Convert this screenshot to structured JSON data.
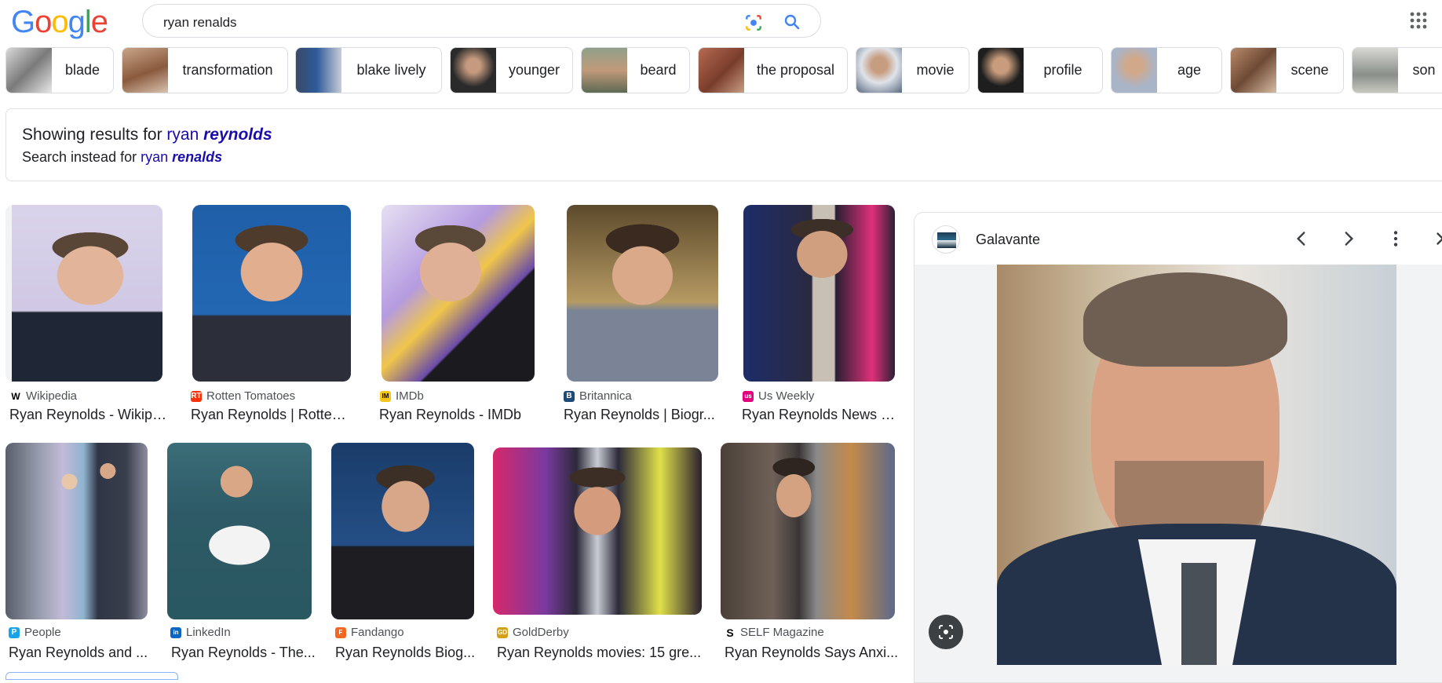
{
  "header": {
    "logo_letters": [
      "G",
      "o",
      "o",
      "g",
      "l",
      "e"
    ],
    "logo_colors": [
      "#4285F4",
      "#EA4335",
      "#FBBC05",
      "#4285F4",
      "#34A853",
      "#EA4335"
    ],
    "search_value": "ryan renalds"
  },
  "chips": [
    {
      "label": "blade"
    },
    {
      "label": "transformation"
    },
    {
      "label": "blake lively"
    },
    {
      "label": "younger"
    },
    {
      "label": "beard"
    },
    {
      "label": "the proposal"
    },
    {
      "label": "movie"
    },
    {
      "label": "profile"
    },
    {
      "label": "age"
    },
    {
      "label": "scene"
    },
    {
      "label": "son"
    }
  ],
  "spelling": {
    "showing_prefix": "Showing results for ",
    "corrected_plain": "ryan ",
    "corrected_bold": "reynolds",
    "instead_prefix": "Search instead for ",
    "original_plain": "ryan ",
    "original_bold": "renalds"
  },
  "results_row1": [
    {
      "source": "Wikipedia",
      "title": "Ryan Reynolds - Wikipe...",
      "fav_color": "#ffffff",
      "fav_text": "W"
    },
    {
      "source": "Rotten Tomatoes",
      "title": "Ryan Reynolds | Rotten ...",
      "fav_color": "#fa320a",
      "fav_text": "RT"
    },
    {
      "source": "IMDb",
      "title": "Ryan Reynolds - IMDb",
      "fav_color": "#f5c518",
      "fav_text": "IM"
    },
    {
      "source": "Britannica",
      "title": "Ryan Reynolds | Biogr...",
      "fav_color": "#1e4a7a",
      "fav_text": "B"
    },
    {
      "source": "Us Weekly",
      "title": "Ryan Reynolds News -...",
      "fav_color": "#e4007c",
      "fav_text": "us"
    }
  ],
  "results_row2": [
    {
      "source": "People",
      "title": "Ryan Reynolds and ...",
      "fav_color": "#1aa3e8",
      "fav_text": "P"
    },
    {
      "source": "LinkedIn",
      "title": "Ryan Reynolds - The...",
      "fav_color": "#0a66c2",
      "fav_text": "in"
    },
    {
      "source": "Fandango",
      "title": "Ryan Reynolds Biog...",
      "fav_color": "#f26722",
      "fav_text": "F"
    },
    {
      "source": "GoldDerby",
      "title": "Ryan Reynolds movies: 15 gre...",
      "fav_color": "#d4a017",
      "fav_text": "GD"
    },
    {
      "source": "SELF Magazine",
      "title": "Ryan Reynolds Says Anxi...",
      "fav_color": "#000000",
      "fav_text": "S"
    }
  ],
  "preview": {
    "site": "Galavante"
  },
  "icons": [
    "google-lens-icon",
    "search-icon",
    "apps-grid-icon",
    "chevron-left-icon",
    "chevron-right-icon",
    "more-vert-icon",
    "close-icon",
    "lens-search-icon"
  ]
}
